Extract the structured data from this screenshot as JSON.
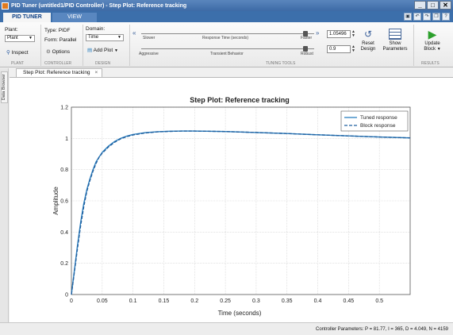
{
  "window": {
    "title": "PID Tuner (untitled1/PID Controller) - Step Plot: Reference tracking",
    "minimize": "_",
    "maximize": "□",
    "close": "✕"
  },
  "tabs": {
    "pid_tuner": "PID TUNER",
    "view": "VIEW"
  },
  "quick_access": [
    "save-icon",
    "undo-icon",
    "redo-icon",
    "copy-icon",
    "help-icon"
  ],
  "ribbon": {
    "plant": {
      "label": "Plant:",
      "value": "Plant",
      "inspect": "Inspect",
      "section": "PLANT"
    },
    "controller": {
      "type": "Type: PIDF",
      "form": "Form: Parallel",
      "options": "Options",
      "section": "CONTROLLER"
    },
    "design": {
      "domain_label": "Domain:",
      "domain_value": "Time",
      "add_plot": "Add Plot",
      "section": "DESIGN"
    },
    "tuning": {
      "slider1_left": "Slower",
      "slider1_center": "Response Time (seconds)",
      "slider1_right": "Faster",
      "slider1_value": "1.05496",
      "slider2_left": "Aggressive",
      "slider2_center": "Transient Behavior",
      "slider2_right": "Robust",
      "slider2_value": "0.9",
      "section": "TUNING TOOLS",
      "reset_line1": "Reset",
      "reset_line2": "Design",
      "show_line1": "Show",
      "show_line2": "Parameters"
    },
    "results": {
      "update_line1": "Update",
      "update_line2": "Block",
      "section": "RESULTS"
    }
  },
  "sidebar": {
    "data_browser": "Data Browser"
  },
  "document_tab": {
    "label": "Step Plot: Reference tracking",
    "close": "×"
  },
  "status": {
    "text": "Controller Parameters: P = 81.77, I = 365, D = 4.049, N = 4159"
  },
  "chart_data": {
    "type": "line",
    "title": "Step Plot: Reference tracking",
    "xlabel": "Time (seconds)",
    "ylabel": "Amplitude",
    "xlim": [
      0,
      0.55
    ],
    "ylim": [
      0,
      1.2
    ],
    "xticks": [
      0,
      0.05,
      0.1,
      0.15,
      0.2,
      0.25,
      0.3,
      0.35,
      0.4,
      0.45,
      0.5
    ],
    "yticks": [
      0,
      0.2,
      0.4,
      0.6,
      0.8,
      1,
      1.2
    ],
    "grid": true,
    "legend_position": "top-right",
    "series": [
      {
        "name": "Tuned response",
        "style": "solid",
        "color": "#2a7fbf",
        "x": [
          0,
          0.005,
          0.01,
          0.015,
          0.02,
          0.025,
          0.03,
          0.035,
          0.04,
          0.045,
          0.05,
          0.06,
          0.07,
          0.08,
          0.09,
          0.1,
          0.12,
          0.14,
          0.16,
          0.18,
          0.2,
          0.25,
          0.3,
          0.35,
          0.4,
          0.45,
          0.5,
          0.55
        ],
        "y": [
          0,
          0.16,
          0.32,
          0.46,
          0.58,
          0.67,
          0.74,
          0.8,
          0.85,
          0.88,
          0.91,
          0.95,
          0.98,
          1.0,
          1.015,
          1.025,
          1.037,
          1.043,
          1.046,
          1.047,
          1.047,
          1.044,
          1.038,
          1.031,
          1.023,
          1.016,
          1.009,
          1.003
        ]
      },
      {
        "name": "Block response",
        "style": "dashed",
        "color": "#1f5f9f",
        "x": [
          0,
          0.005,
          0.01,
          0.015,
          0.02,
          0.025,
          0.03,
          0.035,
          0.04,
          0.045,
          0.05,
          0.06,
          0.07,
          0.08,
          0.09,
          0.1,
          0.12,
          0.14,
          0.16,
          0.18,
          0.2,
          0.25,
          0.3,
          0.35,
          0.4,
          0.45,
          0.5,
          0.55
        ],
        "y": [
          0,
          0.15,
          0.3,
          0.44,
          0.56,
          0.66,
          0.73,
          0.79,
          0.84,
          0.88,
          0.905,
          0.945,
          0.975,
          0.997,
          1.012,
          1.022,
          1.035,
          1.042,
          1.045,
          1.047,
          1.047,
          1.044,
          1.038,
          1.031,
          1.023,
          1.016,
          1.009,
          1.003
        ]
      }
    ]
  }
}
